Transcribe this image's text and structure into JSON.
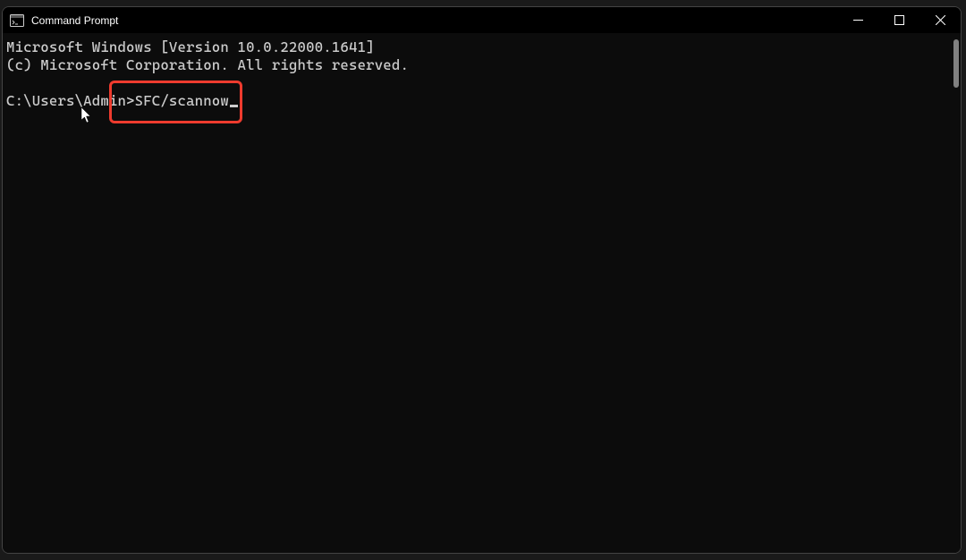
{
  "window": {
    "title": "Command Prompt"
  },
  "terminal": {
    "line1": "Microsoft Windows [Version 10.0.22000.1641]",
    "line2": "(c) Microsoft Corporation. All rights reserved.",
    "prompt": "C:\\Users\\Admin>",
    "command": "SFC/scannow"
  }
}
